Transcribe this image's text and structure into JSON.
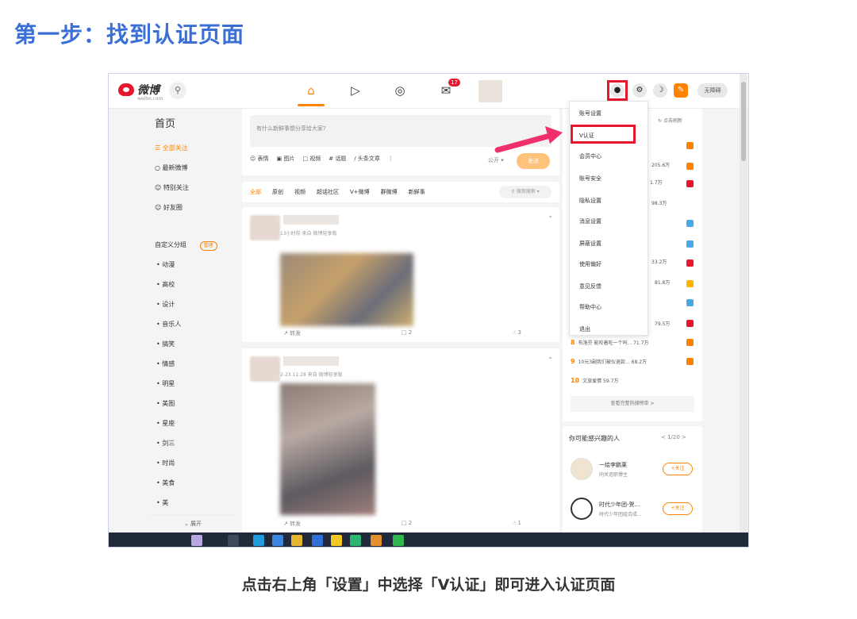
{
  "heading": "第一步：找到认证页面",
  "caption": "点击右上角「设置」中选择「V认证」即可进入认证页面",
  "topbar": {
    "logo_text": "微博",
    "logo_sub": "weibo.com",
    "message_badge": "17",
    "notrace_label": "无障碍"
  },
  "sidebar": {
    "title": "首页",
    "items": [
      "全部关注",
      "最新微博",
      "特别关注",
      "好友圈"
    ],
    "group_title": "自定义分组",
    "manage_label": "管理",
    "groups": [
      "动漫",
      "高校",
      "设计",
      "音乐人",
      "搞笑",
      "情感",
      "明星",
      "美图",
      "星座",
      "剑三",
      "时尚",
      "美食",
      "美"
    ],
    "expand_label": "展开"
  },
  "composer": {
    "placeholder": "有什么新鲜事想分享给大家?",
    "tools": [
      "表情",
      "图片",
      "视频",
      "话题",
      "头条文章"
    ],
    "visibility": "公开",
    "send_label": "发送"
  },
  "tabs": {
    "items": [
      "全部",
      "原创",
      "视频",
      "超话社区",
      "V+微博",
      "群微博",
      "新鲜事"
    ],
    "search_placeholder": "搜我搜索"
  },
  "posts": [
    {
      "meta": "13小时前 来自 微博轻享版",
      "repost": "转发",
      "comments": "2",
      "likes": "3"
    },
    {
      "meta": "2-23 11:28 来自 微博轻享版",
      "repost": "转发",
      "comments": "2",
      "likes": "1"
    }
  ],
  "hot": {
    "refresh_label": "点击刷新",
    "rows": [
      {
        "text": "205.6万"
      },
      {
        "text": "1.7万"
      },
      {
        "text": "98.3万"
      },
      {
        "text": "33.2万"
      },
      {
        "text": "81.8万"
      },
      {
        "text": "79.5万"
      },
      {
        "num": "8",
        "text": "布洛芬 能咬着吃一个吗... 71.7万"
      },
      {
        "num": "9",
        "text": "10元3副我们被仪退款... 68.2万"
      },
      {
        "num": "10",
        "text": "文旅爱情 59.7万"
      }
    ],
    "more_label": "查看完整热搜榜单 >"
  },
  "suggest": {
    "title": "你可能感兴趣的人",
    "page": "< 1/20 >",
    "users": [
      {
        "name": "一绘李鹏莱",
        "desc": "同关追职博主",
        "follow": "+关注"
      },
      {
        "name": "时代少年团-贺...",
        "desc": "时代少年团组合成...",
        "follow": "+关注"
      }
    ]
  },
  "menu": {
    "items": [
      "账号设置",
      "V认证",
      "会员中心",
      "账号安全",
      "隐私设置",
      "消息设置",
      "屏蔽设置",
      "使用偏好",
      "意见反馈",
      "帮助中心",
      "退出"
    ]
  },
  "colors": {
    "accent": "#ff8200",
    "highlight": "#e6162d",
    "heading": "#3b6fd8"
  }
}
